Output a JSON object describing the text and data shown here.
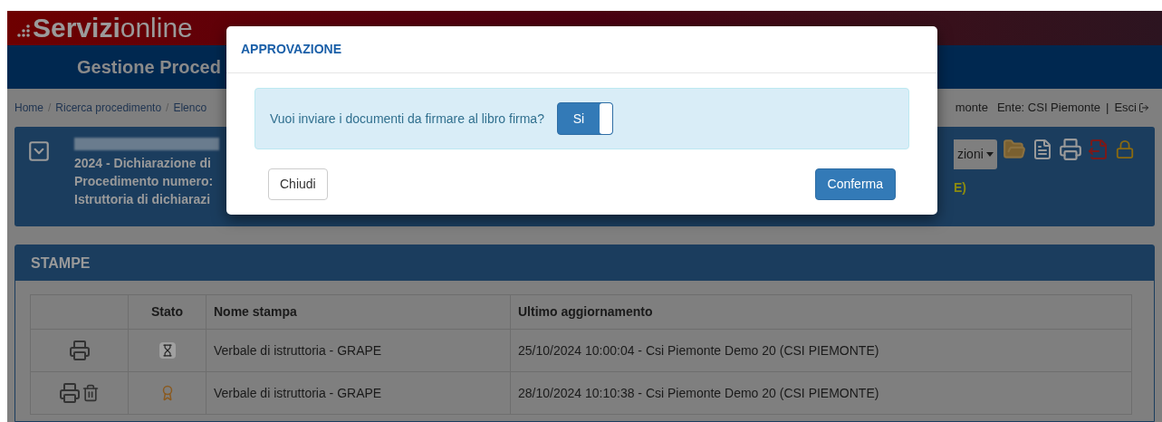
{
  "header": {
    "logo": "**Servizi**online"
  },
  "app_bar": {
    "title": "Gestione Proced"
  },
  "breadcrumb": {
    "items": [
      "Home",
      "Ricerca procedimento",
      "Elenco"
    ],
    "separator": "/"
  },
  "user_bar": {
    "user": "monte",
    "ente": "Ente: CSI Piemonte",
    "separator": "|",
    "logout": "Esci"
  },
  "procedure_panel": {
    "lines": [
      "2024 - Dichiarazione di",
      "Procedimento numero:",
      "Istruttoria di dichiarazi"
    ],
    "actions_menu": "zioni",
    "status_tail": "E)"
  },
  "prints_panel": {
    "title": "STAMPE",
    "columns": [
      "Stato",
      "Nome stampa",
      "Ultimo aggiornamento"
    ],
    "rows": [
      {
        "deletable": false,
        "kind": "pending",
        "name": "Verbale di istruttoria - GRAPE",
        "updated": "25/10/2024 10:00:04 - Csi Piemonte Demo 20 (CSI PIEMONTE)"
      },
      {
        "deletable": true,
        "kind": "signed",
        "name": "Verbale di istruttoria - GRAPE",
        "updated": "28/10/2024 10:10:38 - Csi Piemonte Demo 20 (CSI PIEMONTE)"
      }
    ]
  },
  "modal": {
    "title": "APPROVAZIONE",
    "question": "Vuoi inviare i documenti da firmare al libro firma?",
    "toggle": {
      "label": "Si",
      "on": true
    },
    "buttons": {
      "close": "Chiudi",
      "confirm": "Conferma"
    }
  }
}
